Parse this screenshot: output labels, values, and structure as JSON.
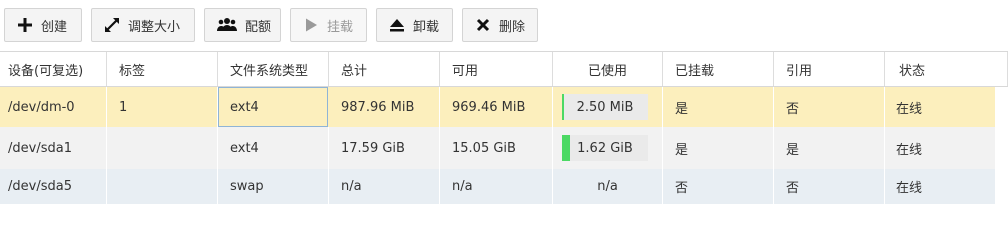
{
  "toolbar": {
    "buttons": [
      {
        "label": "创建",
        "icon": "plus-icon",
        "disabled": false
      },
      {
        "label": "调整大小",
        "icon": "resize-icon",
        "disabled": false
      },
      {
        "label": "配额",
        "icon": "users-icon",
        "disabled": false
      },
      {
        "label": "挂载",
        "icon": "play-icon",
        "disabled": true
      },
      {
        "label": "卸载",
        "icon": "eject-icon",
        "disabled": false
      },
      {
        "label": "删除",
        "icon": "close-icon",
        "disabled": false
      }
    ]
  },
  "table": {
    "columns": [
      "设备(可复选)",
      "标签",
      "文件系统类型",
      "总计",
      "可用",
      "已使用",
      "已挂载",
      "引用",
      "状态"
    ],
    "rows": [
      {
        "device": "/dev/dm-0",
        "label": "1",
        "fstype": "ext4",
        "total": "987.96 MiB",
        "available": "969.46 MiB",
        "used": "2.50 MiB",
        "used_fraction": 0.01,
        "used_color": "#4cd964",
        "mounted": "是",
        "referenced": "否",
        "status": "在线"
      },
      {
        "device": "/dev/sda1",
        "label": "",
        "fstype": "ext4",
        "total": "17.59 GiB",
        "available": "15.05 GiB",
        "used": "1.62 GiB",
        "used_fraction": 0.09,
        "used_color": "#4cd964",
        "mounted": "是",
        "referenced": "是",
        "status": "在线"
      },
      {
        "device": "/dev/sda5",
        "label": "",
        "fstype": "swap",
        "total": "n/a",
        "available": "n/a",
        "used": "n/a",
        "used_fraction": null,
        "used_color": "",
        "mounted": "否",
        "referenced": "否",
        "status": "在线"
      }
    ]
  }
}
